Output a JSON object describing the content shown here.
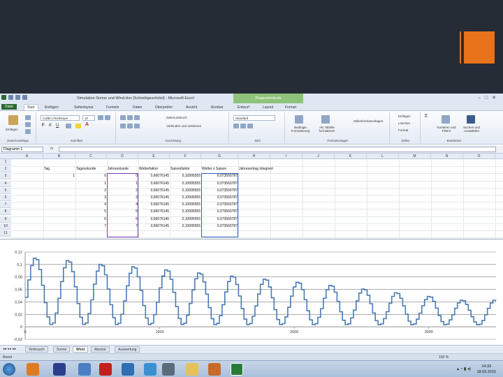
{
  "window": {
    "title": "Simulation Sonne und Wind.xlsx  [Schreibgeschützt] - Microsoft Excel",
    "context_tab": "Diagrammtools"
  },
  "ribbon_tabs": [
    "Datei",
    "Start",
    "Einfügen",
    "Seitenlayout",
    "Formeln",
    "Daten",
    "Überprüfen",
    "Ansicht",
    "Acrobat",
    "Entwurf",
    "Layout",
    "Format"
  ],
  "ribbon": {
    "paste": "Einfügen",
    "font_name": "Calibri (Textkörper",
    "font_size": "10",
    "wrap": "Zeilenumbruch",
    "merge": "Verbinden und zentrieren",
    "number_format": "Standard",
    "cond_format": "Bedingte Formatierung",
    "as_table": "Als Tabelle formatieren",
    "cell_styles": "Zellenformatvorlagen",
    "insert": "Einfügen",
    "delete": "Löschen",
    "format": "Format",
    "sort": "Sortieren und Filtern",
    "find": "Suchen und Auswählen",
    "groups": [
      "Zwischenablage",
      "Schriftart",
      "Ausrichtung",
      "Zahl",
      "Formatvorlagen",
      "Zellen",
      "Bearbeiten"
    ]
  },
  "formula_bar": {
    "name_box": "Diagramm 1",
    "fx": "fx"
  },
  "columns": [
    "A",
    "B",
    "C",
    "D",
    "E",
    "F",
    "G",
    "H",
    "I",
    "J",
    "K",
    "L",
    "M",
    "N",
    "O"
  ],
  "rows": [
    "1",
    "2",
    "3",
    "4",
    "5",
    "6",
    "7",
    "8",
    "9",
    "10",
    "11"
  ],
  "headers": {
    "tag": "Tag",
    "tagesstunde": "Tagesstunde",
    "jahresstunde": "Jahresstunde",
    "wetterfaktor": "Wetterfaktor",
    "saisonfaktor": "Saisonfaktor",
    "wetter_x_saison": "Wetter x Saison",
    "jahresertrag": "Jahresertrag integriert"
  },
  "table_rows": [
    {
      "tag": "1",
      "tagesstunde": "0",
      "jahresstunde": "0",
      "wetter": "0,66076145",
      "saison": "0,10995555",
      "ws": "0,073560787"
    },
    {
      "tag": "",
      "tagesstunde": "1",
      "jahresstunde": "1",
      "wetter": "0,66076145",
      "saison": "0,10995555",
      "ws": "0,073560787"
    },
    {
      "tag": "",
      "tagesstunde": "2",
      "jahresstunde": "2",
      "wetter": "0,66076145",
      "saison": "0,10995555",
      "ws": "0,073560787"
    },
    {
      "tag": "",
      "tagesstunde": "3",
      "jahresstunde": "3",
      "wetter": "0,66076145",
      "saison": "0,10995555",
      "ws": "0,073560787"
    },
    {
      "tag": "",
      "tagesstunde": "4",
      "jahresstunde": "4",
      "wetter": "0,66076145",
      "saison": "0,10995555",
      "ws": "0,073560787"
    },
    {
      "tag": "",
      "tagesstunde": "5",
      "jahresstunde": "5",
      "wetter": "0,66076145",
      "saison": "0,10995555",
      "ws": "0,073560787"
    },
    {
      "tag": "",
      "tagesstunde": "6",
      "jahresstunde": "6",
      "wetter": "0,66076145",
      "saison": "0,10995555",
      "ws": "0,073560787"
    },
    {
      "tag": "",
      "tagesstunde": "7",
      "jahresstunde": "7",
      "wetter": "0,66076145",
      "saison": "0,10995555",
      "ws": "0,073560787"
    }
  ],
  "chart_data": {
    "type": "line",
    "title": "",
    "xlabel": "",
    "ylabel": "",
    "xlim": [
      0,
      3500
    ],
    "ylim": [
      -0.02,
      0.12
    ],
    "y_ticks": [
      "-0,02",
      "0",
      "0,02",
      "0,04",
      "0,06",
      "0,08",
      "0,1",
      "0,12"
    ],
    "x_ticks": [
      "0",
      "1000",
      "2000",
      "3000"
    ],
    "grid": "horizontal",
    "series": [
      {
        "period": 244,
        "steps_per_period": 12,
        "peak_values": [
          0.111,
          0.107,
          0.101,
          0.097,
          0.092,
          0.087,
          0.082,
          0.077,
          0.072,
          0.067,
          0.061,
          0.055,
          0.049,
          0.043
        ],
        "trough_value": 0.003,
        "color": "#4a7ab5"
      }
    ]
  },
  "sheet_tabs": [
    "Verbrauch",
    "Sonne",
    "Wind",
    "Absolut",
    "Auswertung"
  ],
  "active_sheet": "Wind",
  "status": {
    "left": "Bereit",
    "zoom": "100 %"
  },
  "clock": {
    "time": "14:33",
    "date": "18.03.2015"
  },
  "colors": {
    "slide_bg": "#262c35",
    "accent": "#e8731a",
    "excel_green": "#2a6a2f",
    "line": "#4a7ab5"
  }
}
